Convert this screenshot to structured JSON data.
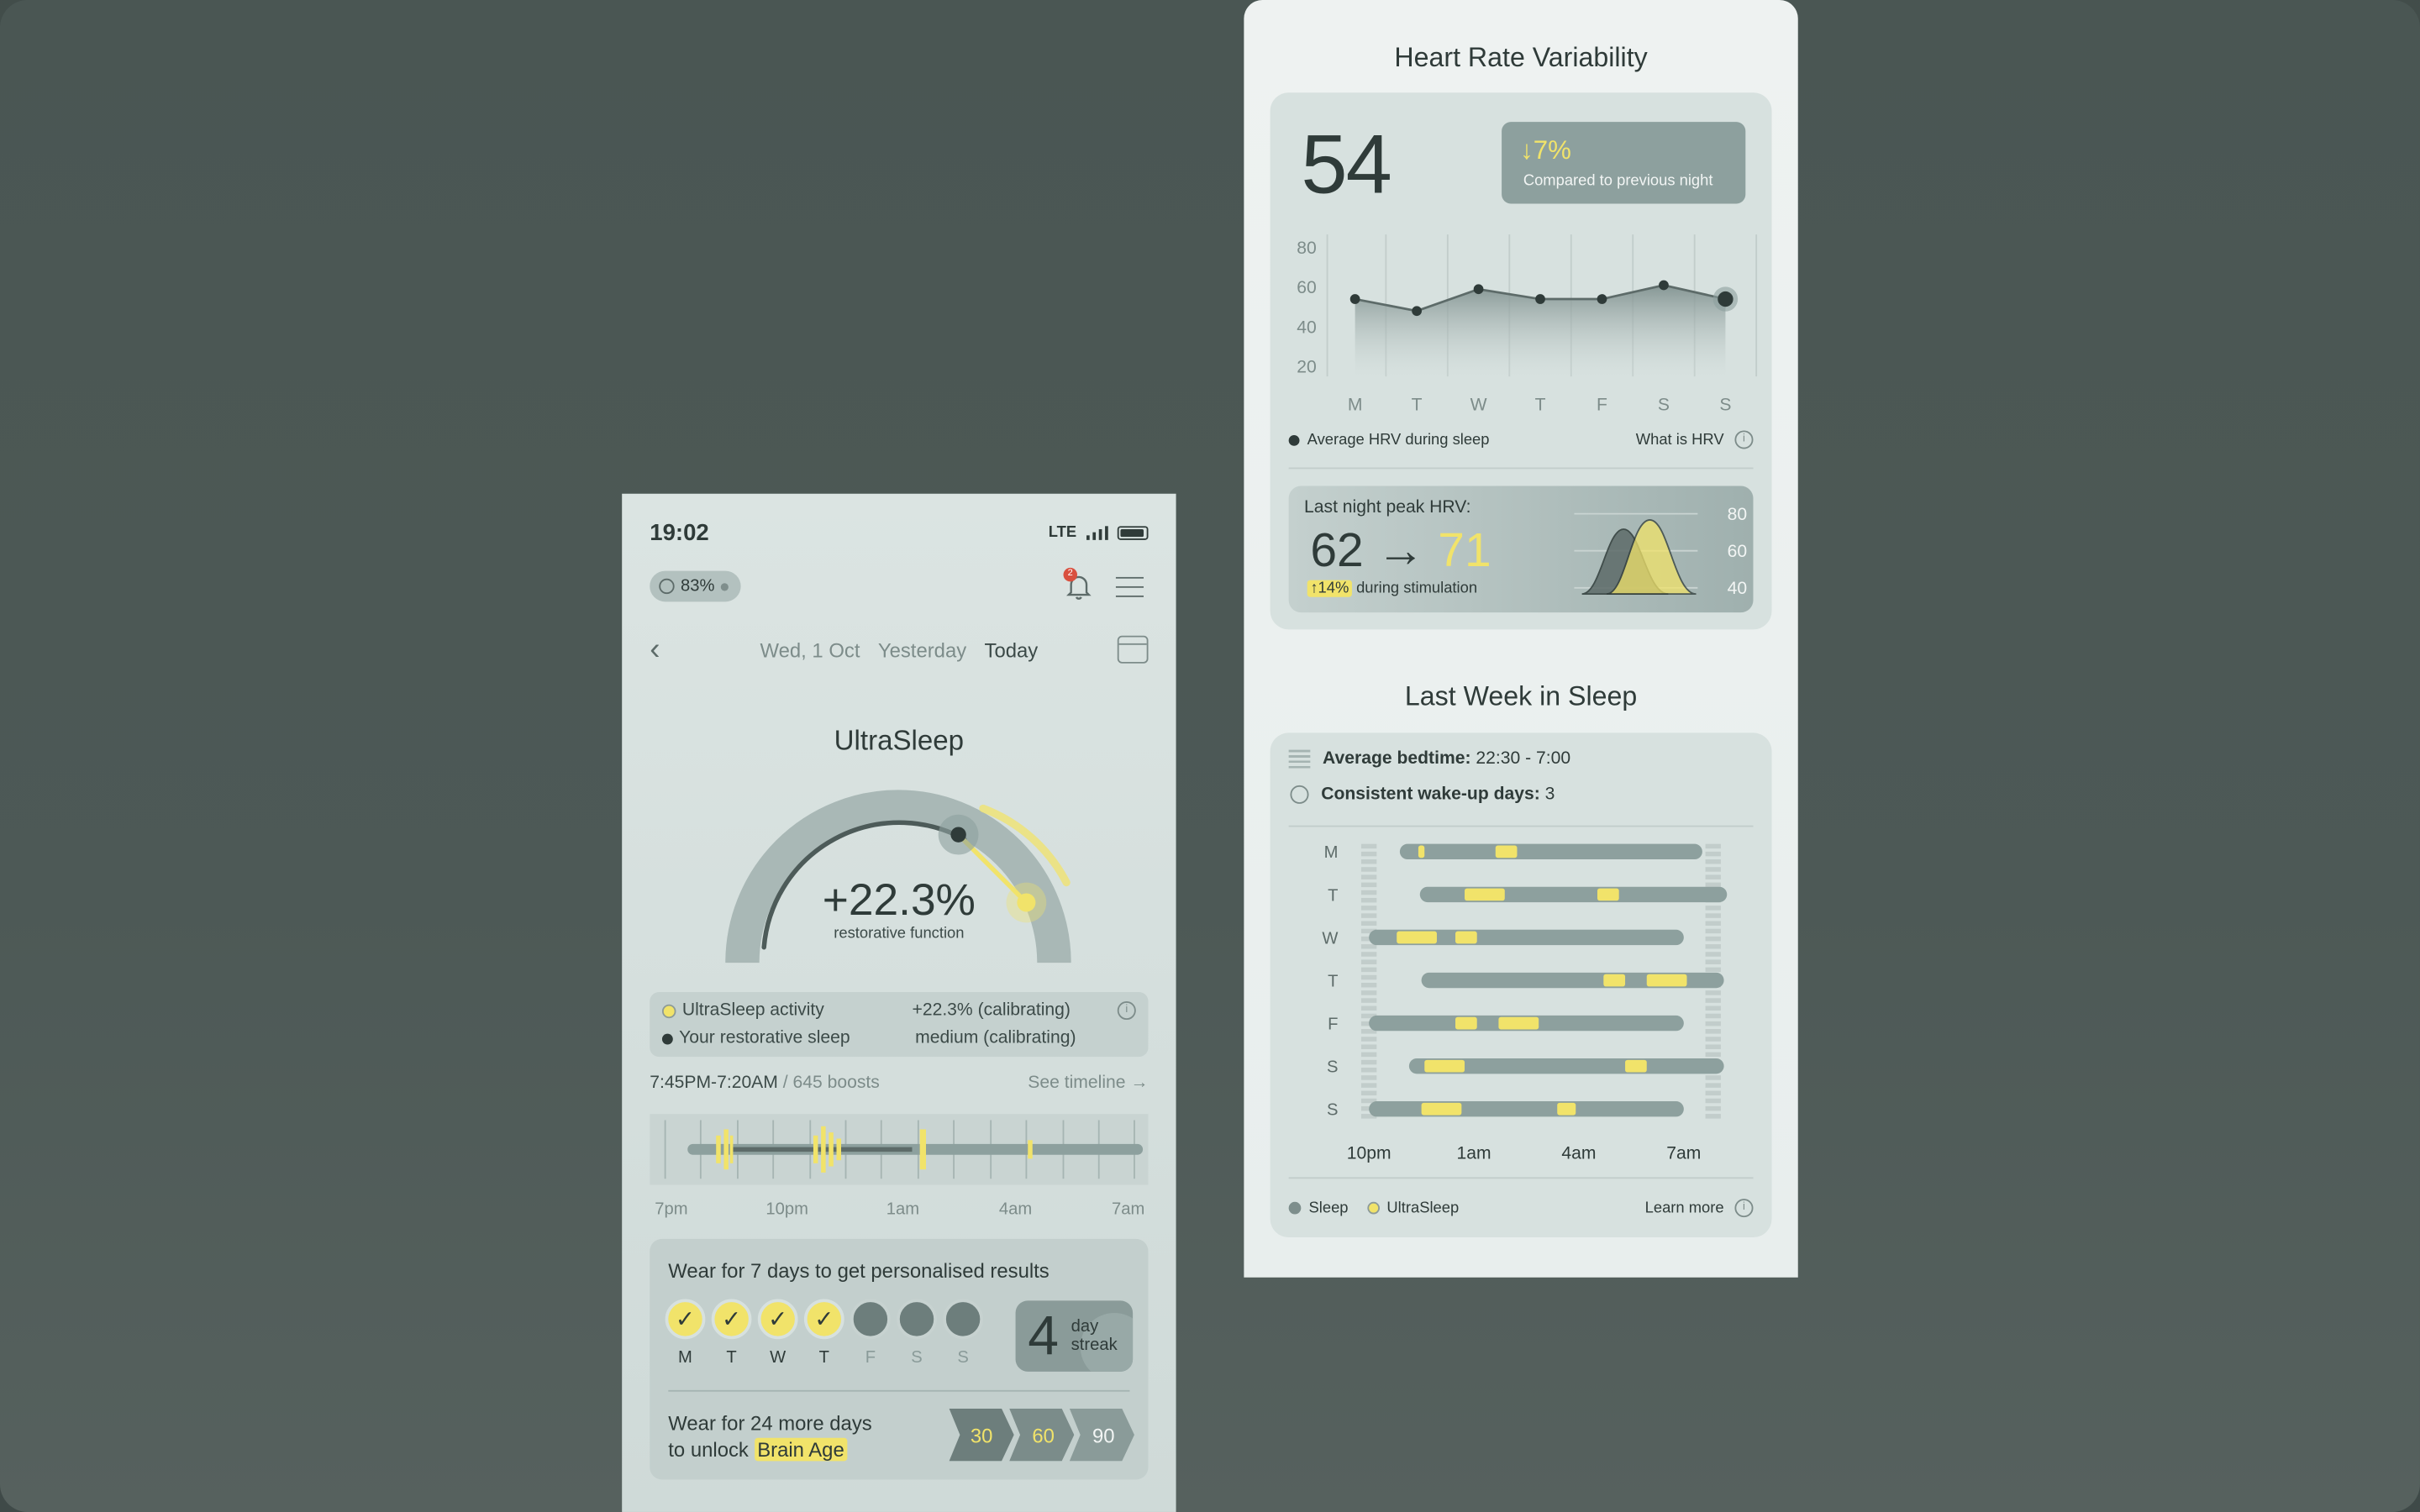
{
  "phone": {
    "status": {
      "time": "19:02",
      "network": "LTE"
    },
    "battery_pill": "83%",
    "notifications_count": "2",
    "date_nav": {
      "date": "Wed, 1 Oct",
      "yesterday": "Yesterday",
      "today": "Today"
    },
    "ultrasleep": {
      "title": "UltraSleep",
      "value": "+22.3%",
      "subtitle": "restorative function"
    },
    "legend": [
      {
        "label": "UltraSleep activity",
        "value": "+22.3% (calibrating)",
        "color": "#f1e36a"
      },
      {
        "label": "Your restorative sleep",
        "value": "medium (calibrating)",
        "color": "#2f3b39"
      }
    ],
    "session": {
      "range": "7:45PM-7:20AM",
      "sep": " / ",
      "boosts": "645 boosts",
      "timeline_link": "See timeline →"
    },
    "timeline_ticks": [
      "7pm",
      "10pm",
      "1am",
      "4am",
      "7am"
    ],
    "wear": {
      "title": "Wear for 7 days to get personalised results",
      "days": [
        {
          "label": "M",
          "done": true
        },
        {
          "label": "T",
          "done": true
        },
        {
          "label": "W",
          "done": true
        },
        {
          "label": "T",
          "done": true
        },
        {
          "label": "F",
          "done": false
        },
        {
          "label": "S",
          "done": false
        },
        {
          "label": "S",
          "done": false
        }
      ],
      "check_glyph": "✓",
      "streak_number": "4",
      "streak_line1": "day",
      "streak_line2": "streak",
      "more_line1": "Wear for 24 more days",
      "more_line2_prefix": "to unlock ",
      "more_highlight": "Brain Age",
      "milestones": [
        "30",
        "60",
        "90"
      ]
    }
  },
  "hrv": {
    "title": "Heart Rate Variability",
    "value": "54",
    "change": "↓7%",
    "change_caption": "Compared to previous night",
    "legend_label": "Average HRV during sleep",
    "what_is": "What is HRV",
    "peak": {
      "title": "Last night peak HRV:",
      "from": "62",
      "arrow": " → ",
      "to": "71",
      "increase": "↑14%",
      "increase_suffix": " during stimulation",
      "axis": [
        "80",
        "60",
        "40"
      ]
    }
  },
  "sleep": {
    "title": "Last Week in Sleep",
    "avg_bedtime_label": "Average bedtime:",
    "avg_bedtime_value": " 22:30 - 7:00",
    "wakeup_label": "Consistent wake-up days:",
    "wakeup_value": " 3",
    "legend_sleep": "Sleep",
    "legend_ultra": "UltraSleep",
    "learn_more": "Learn more"
  },
  "chart_data": [
    {
      "type": "area",
      "x": [
        "M",
        "T",
        "W",
        "T",
        "F",
        "S",
        "S"
      ],
      "series": [
        {
          "name": "Average HRV during sleep",
          "values": [
            54,
            48,
            59,
            54,
            54,
            61,
            54
          ]
        }
      ],
      "ylim": [
        20,
        80
      ],
      "yticks": [
        80,
        60,
        40,
        20
      ]
    },
    {
      "type": "line",
      "yticks": [
        80,
        60,
        40
      ]
    },
    {
      "type": "bar",
      "categories": [
        "M",
        "T",
        "W",
        "T",
        "F",
        "S",
        "S"
      ],
      "xticks": [
        "10pm",
        "1am",
        "4am",
        "7am"
      ]
    }
  ],
  "colors": {
    "accent": "#f1e36a",
    "dark": "#2f3b39",
    "muted": "#7d8c8a"
  }
}
